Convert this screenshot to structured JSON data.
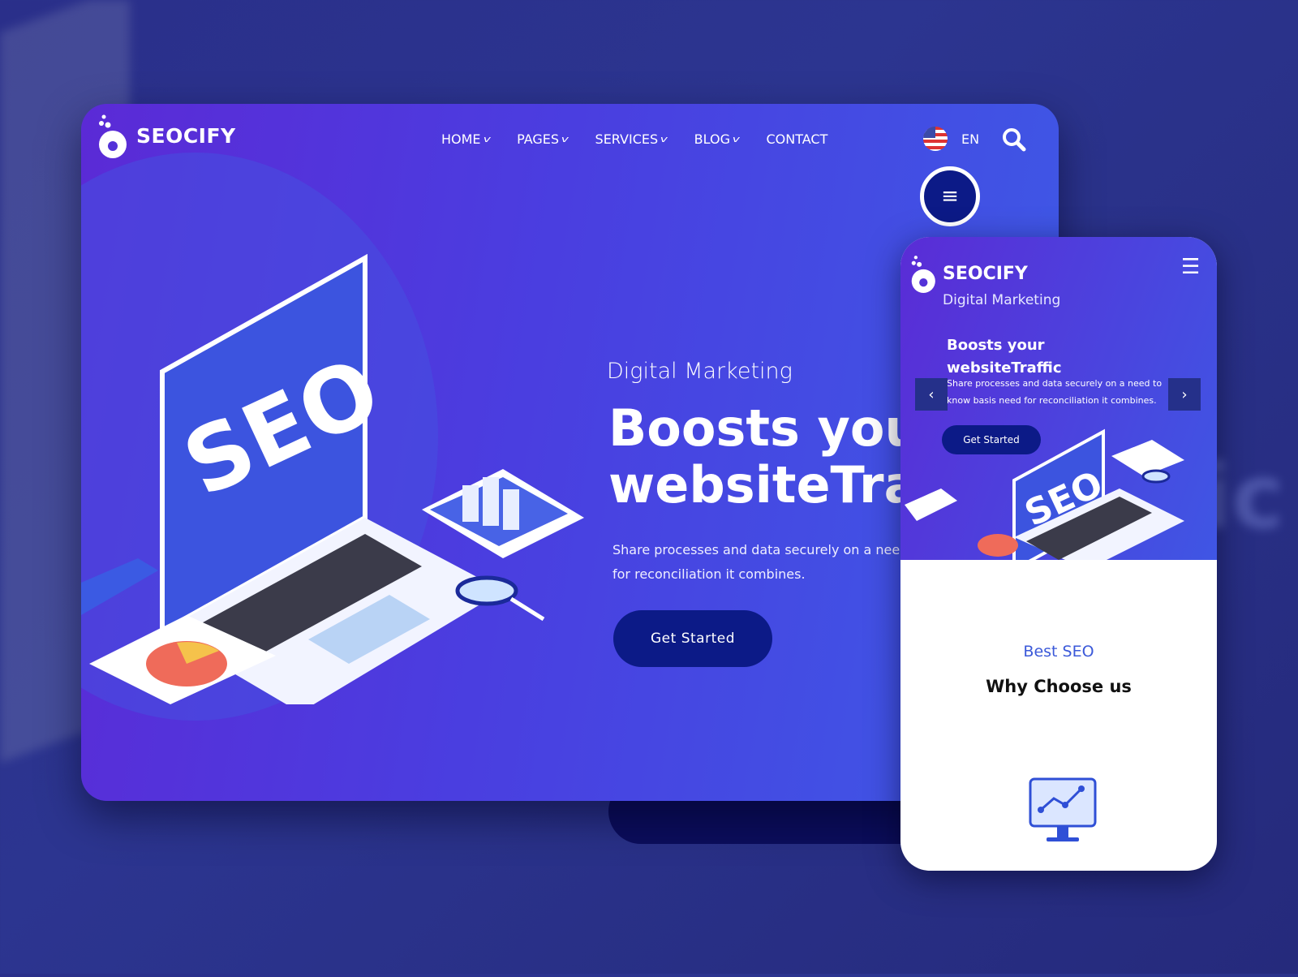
{
  "brand": {
    "name": "SEOCIFY"
  },
  "nav": {
    "items": [
      {
        "label": "HOME",
        "has_dropdown": true
      },
      {
        "label": "PAGES",
        "has_dropdown": true
      },
      {
        "label": "SERVICES",
        "has_dropdown": true
      },
      {
        "label": "BLOG",
        "has_dropdown": true
      },
      {
        "label": "CONTACT",
        "has_dropdown": false
      }
    ],
    "language": "EN",
    "icons": [
      "us-flag-icon",
      "search-icon",
      "hamburger-menu-icon"
    ]
  },
  "hero": {
    "subtitle": "Digital Marketing",
    "title_line1": "Boosts your",
    "title_line2": "websiteTraffic",
    "paragraph_line1": "Share processes and data securely on a need to know basis need",
    "paragraph_line2": "for reconciliation it combines.",
    "button": "Get Started",
    "illustration_text": "SEO"
  },
  "mobile": {
    "brand": "SEOCIFY",
    "subtitle": "Digital Marketing",
    "title_line1": "Boosts your",
    "title_line2": "websiteTraffic",
    "paragraph_line1": "Share processes and data securely on a need to",
    "paragraph_line2": "know basis need for reconciliation it combines.",
    "button": "Get Started",
    "section_kicker": "Best SEO",
    "section_title": "Why Choose us",
    "prev": "‹",
    "next": "›"
  },
  "colors": {
    "primary_dark": "#0c1a87",
    "gradient_start": "#5b2ad6",
    "gradient_end": "#3d5ae6",
    "accent_text": "#3b59d9"
  }
}
